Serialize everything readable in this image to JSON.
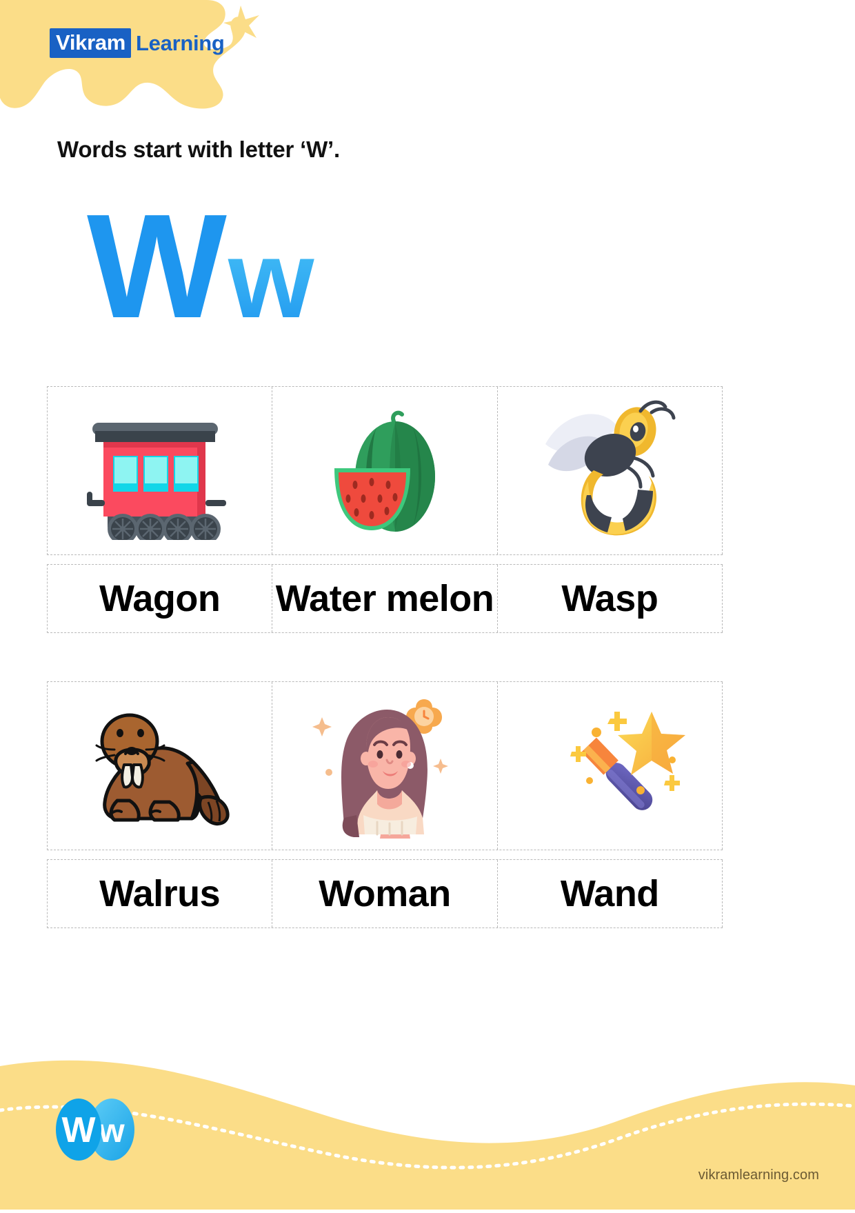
{
  "brand": {
    "logo_mark": "Vikram",
    "logo_word": "Learning",
    "footer_url": "vikramlearning.com",
    "footer_badge_upper": "W",
    "footer_badge_lower": "w",
    "colors": {
      "brand_blue": "#1961c4",
      "accent_yellow": "#fbdd88",
      "letter_blue": "#1e96ef",
      "letter_blue_light": "#4cc6f7",
      "badge_blue": "#0fa3e8"
    }
  },
  "worksheet": {
    "title": "Words start with letter ‘W’.",
    "letter_uppercase": "W",
    "letter_lowercase": "w"
  },
  "rows": [
    {
      "cells": [
        {
          "label": "Wagon",
          "icon": "wagon-icon"
        },
        {
          "label": "Water melon",
          "icon": "watermelon-icon"
        },
        {
          "label": "Wasp",
          "icon": "wasp-icon"
        }
      ]
    },
    {
      "cells": [
        {
          "label": "Walrus",
          "icon": "walrus-icon"
        },
        {
          "label": "Woman",
          "icon": "woman-icon"
        },
        {
          "label": "Wand",
          "icon": "wand-icon"
        }
      ]
    }
  ]
}
